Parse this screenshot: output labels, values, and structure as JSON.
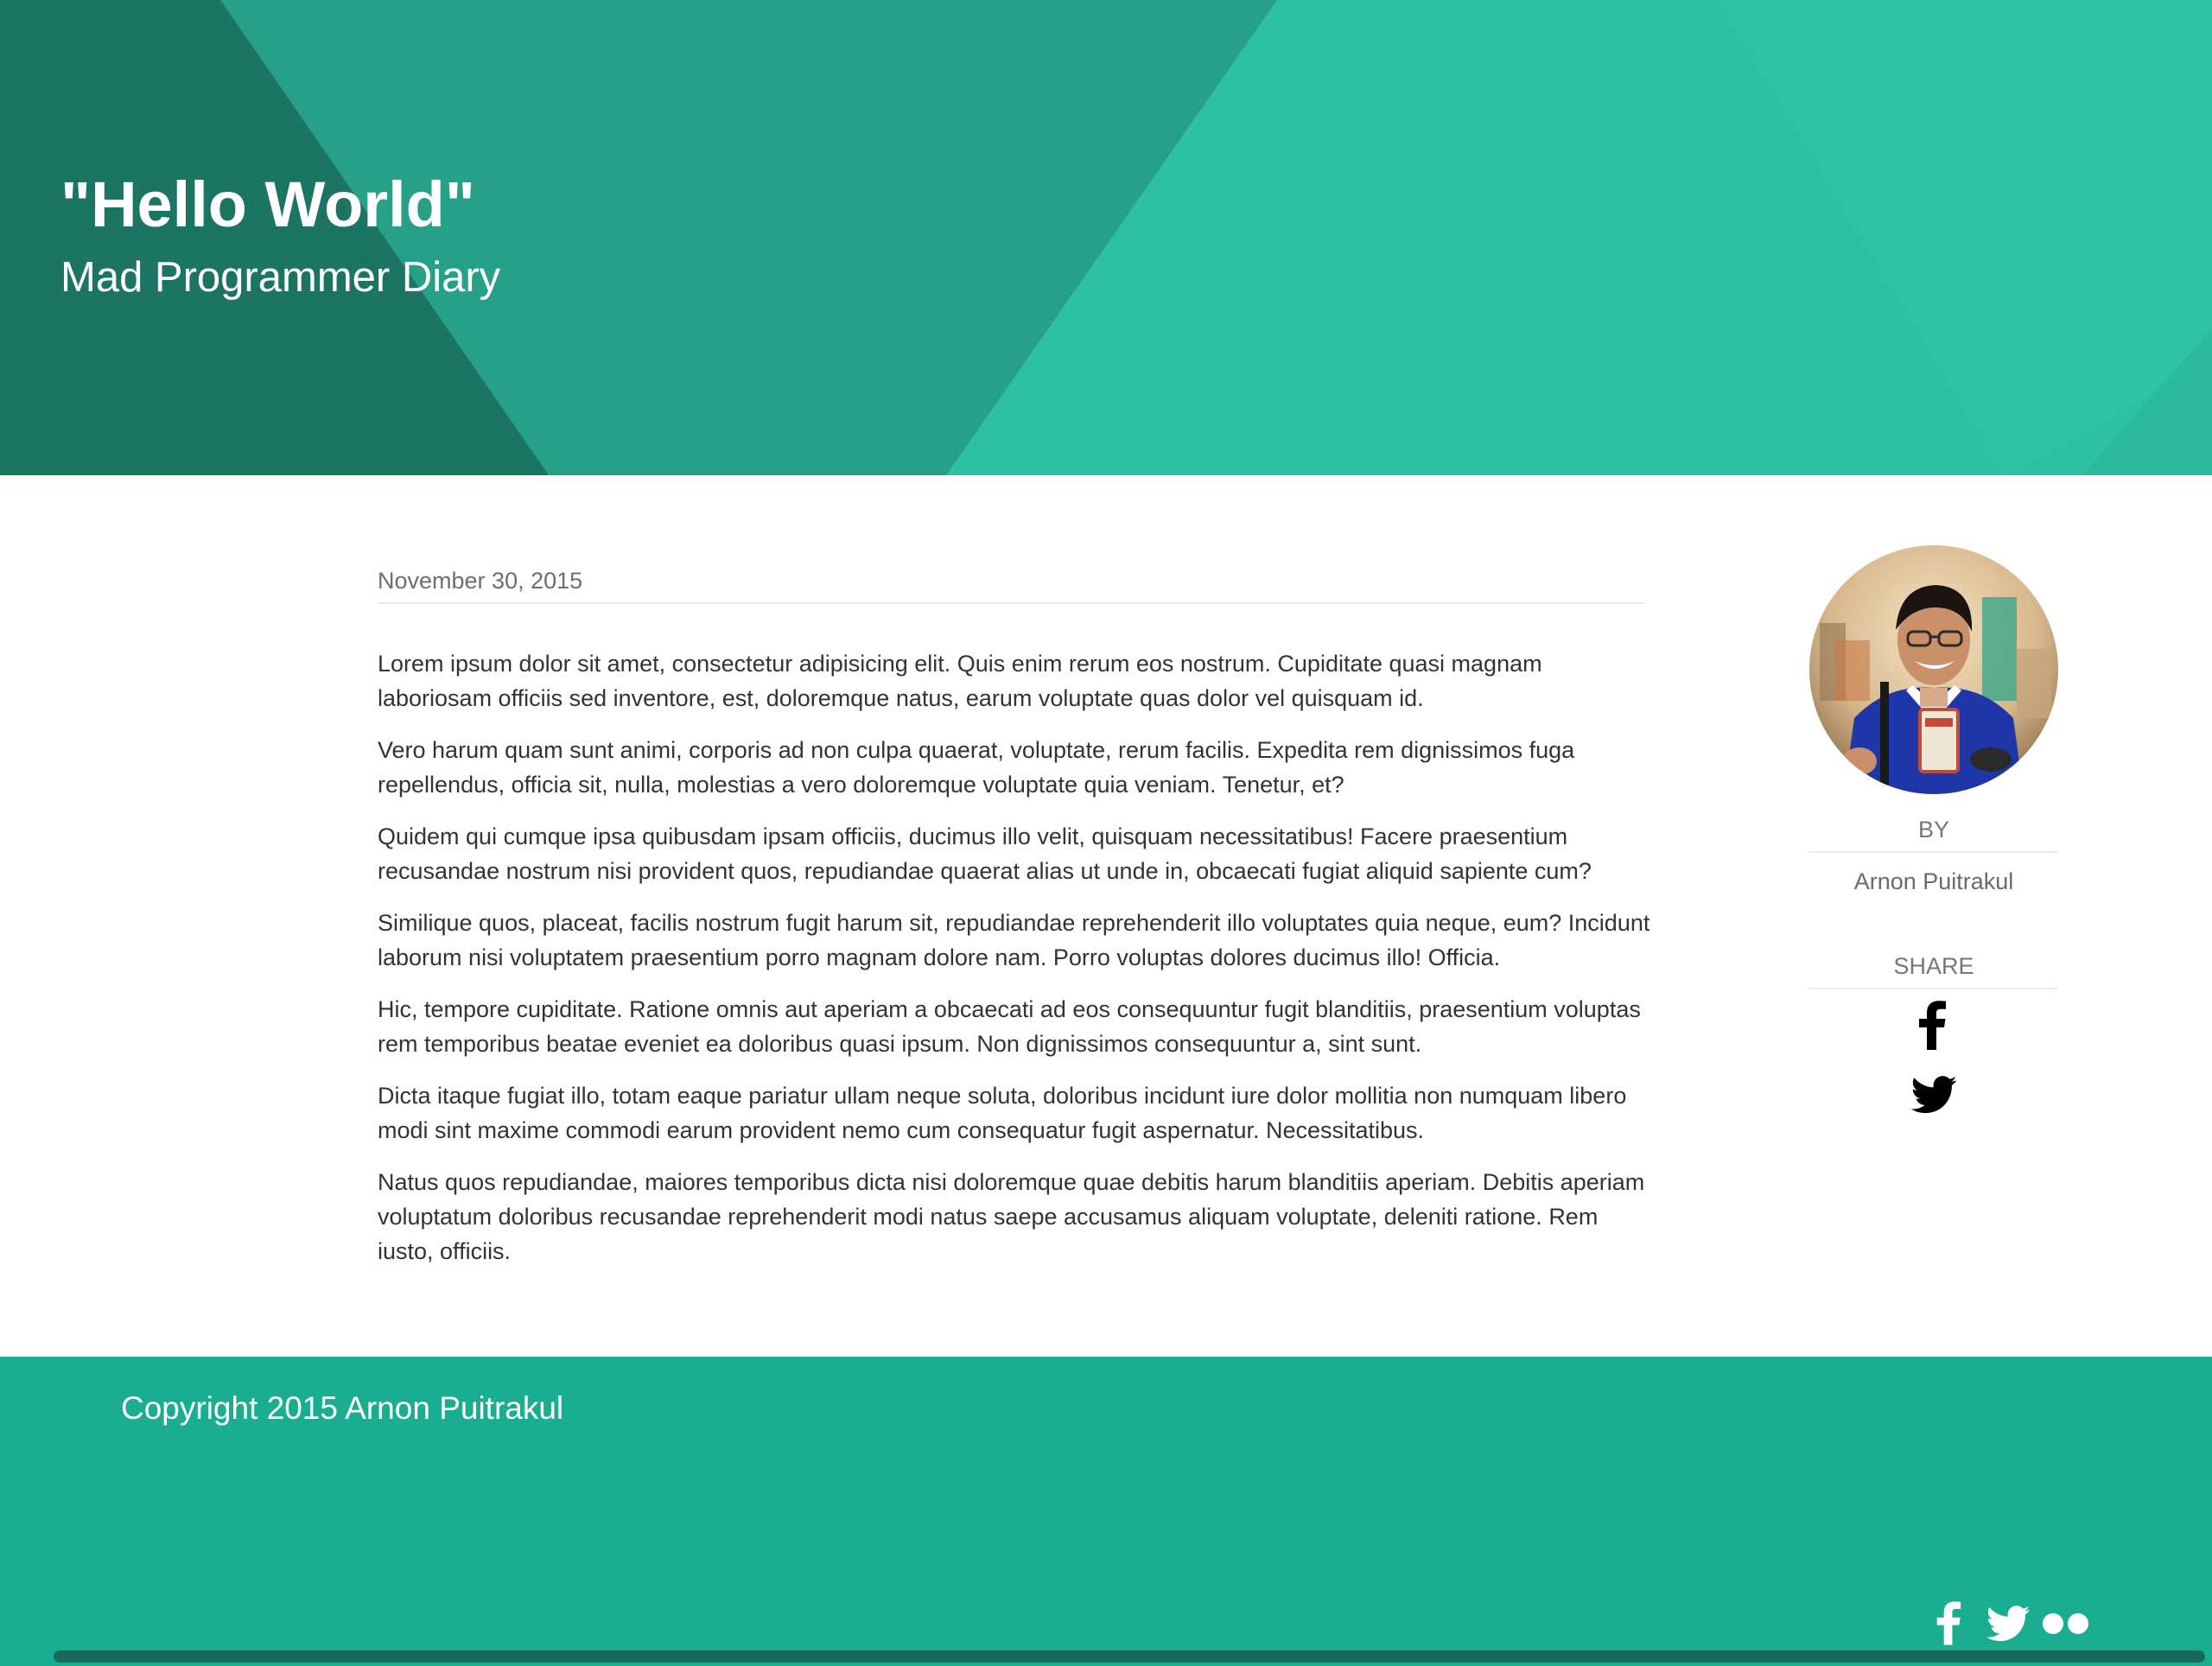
{
  "header": {
    "title": "\"Hello World\"",
    "subtitle": "Mad Programmer Diary"
  },
  "post": {
    "date": "November 30, 2015",
    "paragraphs": [
      "Lorem ipsum dolor sit amet, consectetur adipisicing elit. Quis enim rerum eos nostrum. Cupiditate quasi magnam laboriosam officiis sed inventore, est, doloremque natus, earum voluptate quas dolor vel quisquam id.",
      "Vero harum quam sunt animi, corporis ad non culpa quaerat, voluptate, rerum facilis. Expedita rem dignissimos fuga repellendus, officia sit, nulla, molestias a vero doloremque voluptate quia veniam. Tenetur, et?",
      "Quidem qui cumque ipsa quibusdam ipsam officiis, ducimus illo velit, quisquam necessitatibus! Facere praesentium recusandae nostrum nisi provident quos, repudiandae quaerat alias ut unde in, obcaecati fugiat aliquid sapiente cum?",
      "Similique quos, placeat, facilis nostrum fugit harum sit, repudiandae reprehenderit illo voluptates quia neque, eum? Incidunt laborum nisi voluptatem praesentium porro magnam dolore nam. Porro voluptas dolores ducimus illo! Officia.",
      "Hic, tempore cupiditate. Ratione omnis aut aperiam a obcaecati ad eos consequuntur fugit blanditiis, praesentium voluptas rem temporibus beatae eveniet ea doloribus quasi ipsum. Non dignissimos consequuntur a, sint sunt.",
      "Dicta itaque fugiat illo, totam eaque pariatur ullam neque soluta, doloribus incidunt iure dolor mollitia non numquam libero modi sint maxime commodi earum provident nemo cum consequatur fugit aspernatur. Necessitatibus.",
      "Natus quos repudiandae, maiores temporibus dicta nisi doloremque quae debitis harum blanditiis aperiam. Debitis aperiam voluptatum doloribus recusandae reprehenderit modi natus saepe accusamus aliquam voluptate, deleniti ratione. Rem iusto, officiis."
    ]
  },
  "author": {
    "by_label": "BY",
    "name": "Arnon Puitrakul",
    "share_label": "SHARE",
    "share_icons": [
      "facebook-icon",
      "twitter-icon"
    ]
  },
  "footer": {
    "copyright": "Copyright 2015 Arnon Puitrakul",
    "social_icons": [
      "facebook-icon",
      "twitter-icon",
      "flickr-icon"
    ]
  },
  "colors": {
    "header_light": "#2ec0a2",
    "header_mid": "#26a086",
    "header_dark": "#1c7462",
    "footer": "#1aad8f",
    "footer_bar": "#1a6a5a"
  }
}
